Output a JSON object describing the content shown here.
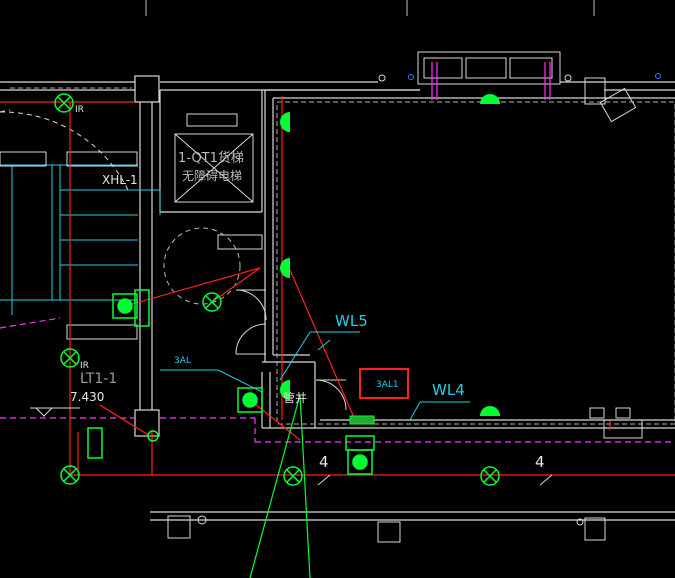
{
  "labels": {
    "elevator_line1": "1-QT1货梯",
    "elevator_line2": "无障碍电梯",
    "xhl": "XHL-1",
    "ir_top": "IR",
    "ir_left": "IR",
    "lt": "LT1-1",
    "elevation": "7.430",
    "wl5": "WL5",
    "wl4": "WL4",
    "tag_3al": "3AL",
    "tag_3al1": "3AL1",
    "shaft": "管井",
    "count_left": "4",
    "count_right": "4"
  },
  "colors": {
    "background": "#000000",
    "wall": "#d8d8d8",
    "circuit": "#ff2020",
    "fixture": "#00ff33",
    "label": "#1fd0e6",
    "stair": "#1fd0e6",
    "dashed": "#ff33ff",
    "highlight": "#ff2020"
  }
}
